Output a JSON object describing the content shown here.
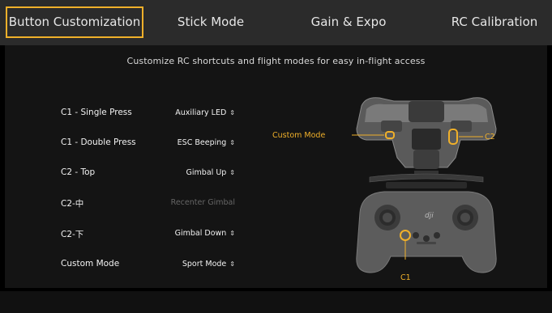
{
  "tabs": [
    {
      "label": "Button Customization",
      "active": true
    },
    {
      "label": "Stick Mode",
      "active": false
    },
    {
      "label": "Gain & Expo",
      "active": false
    },
    {
      "label": "RC Calibration",
      "active": false
    }
  ],
  "subtitle": "Customize RC shortcuts and flight modes for easy in-flight access",
  "rows": [
    {
      "label": "C1 - Single Press",
      "value": "Auxiliary LED",
      "enabled": true
    },
    {
      "label": "C1 - Double Press",
      "value": "ESC Beeping",
      "enabled": true
    },
    {
      "label": "C2 - Top",
      "value": "Gimbal Up",
      "enabled": true
    },
    {
      "label": "C2-中",
      "value": "Recenter Gimbal",
      "enabled": false
    },
    {
      "label": "C2-下",
      "value": "Gimbal Down",
      "enabled": true
    },
    {
      "label": "Custom Mode",
      "value": "Sport Mode",
      "enabled": true
    }
  ],
  "dropdown_glyph": "⇕",
  "diagram": {
    "custom_mode_label": "Custom Mode",
    "c2_label": "C2",
    "c1_label": "C1",
    "logo_text": "dji"
  },
  "colors": {
    "accent": "#f0b02a",
    "tab_bar": "#2b2b2b",
    "panel": "#141414"
  }
}
